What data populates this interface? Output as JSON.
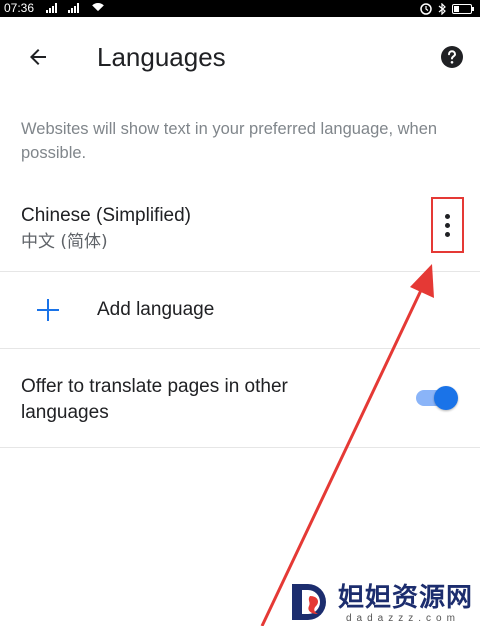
{
  "status_bar": {
    "time": "07:36",
    "icons": [
      "signal-icon",
      "signal-icon",
      "wifi-icon",
      "alarm-icon",
      "bluetooth-icon",
      "battery-icon"
    ]
  },
  "app_bar": {
    "title": "Languages",
    "back_icon": "arrow-back-icon",
    "help_icon": "help-icon"
  },
  "description": "Websites will show text in your preferred language, when possible.",
  "languages": [
    {
      "name": "Chinese (Simplified)",
      "native": "中文 (简体)",
      "menu_icon": "more-vert-icon"
    }
  ],
  "add_language": {
    "label": "Add language",
    "icon": "plus-icon"
  },
  "offer_translate": {
    "label": "Offer to translate pages in other languages",
    "enabled": true
  },
  "annotation": {
    "color": "#e53935"
  },
  "watermark": {
    "title": "妲妲资源网",
    "subtitle": "dadazzz.com"
  },
  "colors": {
    "accent": "#1a73e8",
    "accent_light": "#8ab4f8",
    "highlight": "#e53935"
  }
}
